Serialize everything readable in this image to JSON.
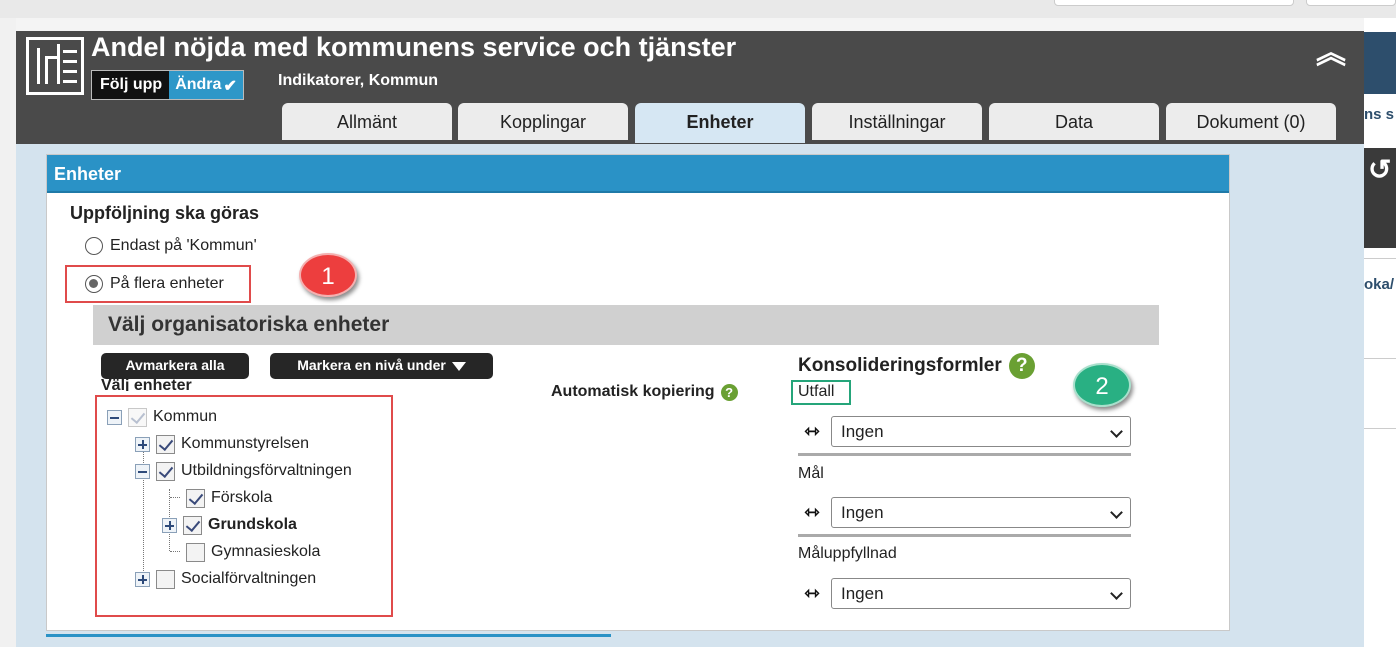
{
  "dialog": {
    "title": "Andel nöjda med kommunens service och tjänster",
    "subtitle": "Indikatorer, Kommun",
    "follow_label": "Följ upp",
    "edit_label": "Ändra",
    "edit_check": "✔",
    "collapse_glyph": "︽"
  },
  "tabs": [
    {
      "label": "Allmänt"
    },
    {
      "label": "Kopplingar"
    },
    {
      "label": "Enheter"
    },
    {
      "label": "Inställningar"
    },
    {
      "label": "Data"
    },
    {
      "label": "Dokument (0)"
    }
  ],
  "active_tab": "Enheter",
  "panel": {
    "header": "Enheter",
    "followup_title": "Uppföljning ska göras",
    "radio_options": [
      {
        "label": "Endast på 'Kommun'",
        "checked": false
      },
      {
        "label": "På flera enheter",
        "checked": true
      }
    ],
    "org_units_title": "Välj organisatoriska enheter",
    "deselect_all_label": "Avmarkera alla",
    "mark_level_label": "Markera en nivå under",
    "select_units_label": "Välj enheter",
    "tree": [
      {
        "label": "Kommun",
        "checked": true,
        "expander": "minus",
        "bold": false
      },
      {
        "label": "Kommunstyrelsen",
        "checked": true,
        "expander": "plus",
        "bold": false
      },
      {
        "label": "Utbildningsförvaltningen",
        "checked": true,
        "expander": "minus",
        "bold": false
      },
      {
        "label": "Förskola",
        "checked": true,
        "expander": "none",
        "bold": false
      },
      {
        "label": "Grundskola",
        "checked": true,
        "expander": "plus",
        "bold": true
      },
      {
        "label": "Gymnasieskola",
        "checked": false,
        "expander": "none",
        "bold": false
      },
      {
        "label": "Socialförvaltningen",
        "checked": false,
        "expander": "plus",
        "bold": false
      }
    ],
    "auto_copy_label": "Automatisk kopiering",
    "consolidation": {
      "title": "Konsolideringsformler",
      "rows": [
        {
          "label": "Utfall",
          "value": "Ingen"
        },
        {
          "label": "Mål",
          "value": "Ingen"
        },
        {
          "label": "Måluppfyllnad",
          "value": "Ingen"
        }
      ]
    },
    "help_glyph": "?",
    "link_glyph": "⇿"
  },
  "annotations": {
    "badge_1": "1",
    "badge_2": "2"
  },
  "background": {
    "right_text_1": "ns s",
    "right_text_2": "oka/",
    "right_icon_text": "↺"
  },
  "colors": {
    "header_bg": "#4a4a4a",
    "accent_blue": "#2a92c6",
    "highlight_red": "#e04b4b",
    "highlight_green": "#25a57a",
    "help_green": "#6aa033"
  }
}
